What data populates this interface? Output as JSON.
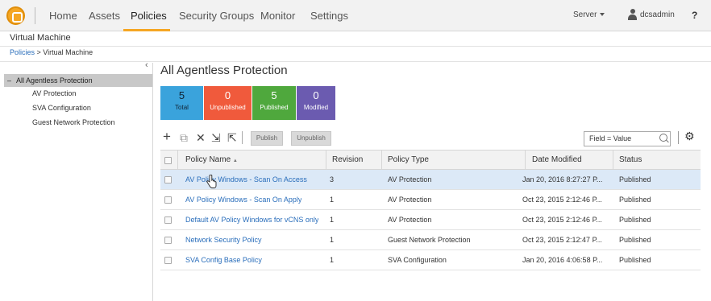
{
  "nav": {
    "items": [
      "Home",
      "Assets",
      "Policies",
      "Security Groups",
      "Monitor",
      "Settings"
    ],
    "active": "Policies",
    "server_label": "Server",
    "user_label": "dcsadmin",
    "help_label": "?"
  },
  "page": {
    "title": "Virtual Machine",
    "breadcrumb": {
      "link": "Policies",
      "separator": " > ",
      "current": "Virtual Machine"
    }
  },
  "sidebar": {
    "collapse_glyph": "‹",
    "root": {
      "toggle": "–",
      "label": "All Agentless Protection"
    },
    "items": [
      "AV Protection",
      "SVA Configuration",
      "Guest Network Protection"
    ]
  },
  "main": {
    "title": "All Agentless Protection",
    "tiles": [
      {
        "count": "5",
        "label": "Total",
        "color": "#3aa3dc"
      },
      {
        "count": "0",
        "label": "Unpublished",
        "color": "#f05a3c"
      },
      {
        "count": "5",
        "label": "Published",
        "color": "#4fa83d"
      },
      {
        "count": "0",
        "label": "Modified",
        "color": "#6b5bb0"
      }
    ],
    "toolbar": {
      "icons": [
        "plus-icon",
        "copy-icon",
        "delete-icon",
        "import-icon",
        "export-icon"
      ],
      "publish_label": "Publish",
      "unpublish_label": "Unpublish",
      "filter_placeholder": "Field = Value"
    },
    "table": {
      "columns": [
        "Policy Name",
        "Revision",
        "Policy Type",
        "Date Modified",
        "Status"
      ],
      "sort_indicator": "▲",
      "rows": [
        {
          "name": "AV Policy Windows - Scan On Access",
          "revision": "3",
          "type": "AV Protection",
          "date": "Jan 20, 2016 8:27:27 P...",
          "status": "Published"
        },
        {
          "name": "AV Policy Windows - Scan On Apply",
          "revision": "1",
          "type": "AV Protection",
          "date": "Oct 23, 2015 2:12:46 P...",
          "status": "Published"
        },
        {
          "name": "Default AV Policy Windows for vCNS only",
          "revision": "1",
          "type": "AV Protection",
          "date": "Oct 23, 2015 2:12:46 P...",
          "status": "Published"
        },
        {
          "name": "Network Security Policy",
          "revision": "1",
          "type": "Guest Network Protection",
          "date": "Oct 23, 2015 2:12:47 P...",
          "status": "Published"
        },
        {
          "name": "SVA Config Base Policy",
          "revision": "1",
          "type": "SVA Configuration",
          "date": "Jan 20, 2016 4:06:58 P...",
          "status": "Published"
        }
      ]
    }
  }
}
